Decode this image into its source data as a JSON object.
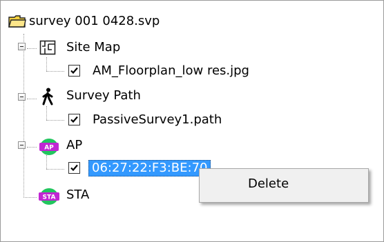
{
  "tree": {
    "root": {
      "label": "survey 001 0428.svp",
      "icon": "folder-icon"
    },
    "nodes": [
      {
        "label": "Site Map",
        "icon": "site-map-icon",
        "children": [
          {
            "label": "AM_Floorplan_low res.jpg",
            "checked": true
          }
        ]
      },
      {
        "label": "Survey Path",
        "icon": "walking-person-icon",
        "children": [
          {
            "label": "PassiveSurvey1.path",
            "checked": true
          }
        ]
      },
      {
        "label": "AP",
        "icon": "ap-badge-icon",
        "badge_text": "AP",
        "children": [
          {
            "label": "06:27:22:F3:BE:70",
            "checked": true,
            "selected": true
          }
        ]
      },
      {
        "label": "STA",
        "icon": "sta-badge-icon",
        "badge_text": "STA",
        "children": []
      }
    ]
  },
  "context_menu": {
    "items": [
      {
        "label": "Delete"
      }
    ]
  },
  "colors": {
    "selection": "#3399ff",
    "badge_green": "#22c55e",
    "badge_purple": "#c026d3",
    "folder_yellow": "#f4d03f"
  }
}
